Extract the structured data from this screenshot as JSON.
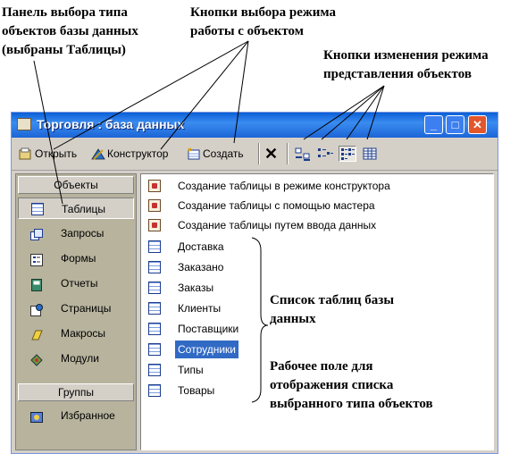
{
  "annotations": {
    "panel": [
      "Панель  выбора типа",
      "объектов базы данных",
      "(выбраны Таблицы)"
    ],
    "mode_buttons": [
      "Кнопки выбора режима",
      "работы с объектом"
    ],
    "view_buttons": [
      "Кнопки изменения режима",
      "представления объектов"
    ],
    "table_list": [
      "Список таблиц базы",
      "данных"
    ],
    "workspace": [
      "Рабочее поле для",
      "отображения списка",
      "выбранного типа объектов"
    ]
  },
  "window": {
    "title": "Торговля : база данных",
    "minimize": "_",
    "maximize": "□",
    "close": "✕"
  },
  "toolbar": {
    "open_label": "Открыть",
    "design_label": "Конструктор",
    "create_label": "Создать",
    "delete_label": "✕"
  },
  "sidebar": {
    "objects_header": "Объекты",
    "items": [
      {
        "label": "Таблицы",
        "icon": "table-icon"
      },
      {
        "label": "Запросы",
        "icon": "query-icon"
      },
      {
        "label": "Формы",
        "icon": "form-icon"
      },
      {
        "label": "Отчеты",
        "icon": "report-icon"
      },
      {
        "label": "Страницы",
        "icon": "page-icon"
      },
      {
        "label": "Макросы",
        "icon": "macro-icon"
      },
      {
        "label": "Модули",
        "icon": "module-icon"
      }
    ],
    "groups_header": "Группы",
    "groups": [
      {
        "label": "Избранное",
        "icon": "favorites-icon"
      }
    ]
  },
  "content": {
    "wizards": [
      "Создание таблицы в режиме конструктора",
      "Создание таблицы с помощью мастера",
      "Создание таблицы путем ввода данных"
    ],
    "tables": [
      "Доставка",
      "Заказано",
      "Заказы",
      "Клиенты",
      "Поставщики",
      "Сотрудники",
      "Типы",
      "Товары"
    ],
    "selected_table": "Сотрудники"
  },
  "colors": {
    "title_bar": "#0a5fd7",
    "selection": "#316ac5",
    "sidebar": "#b7b39d"
  }
}
